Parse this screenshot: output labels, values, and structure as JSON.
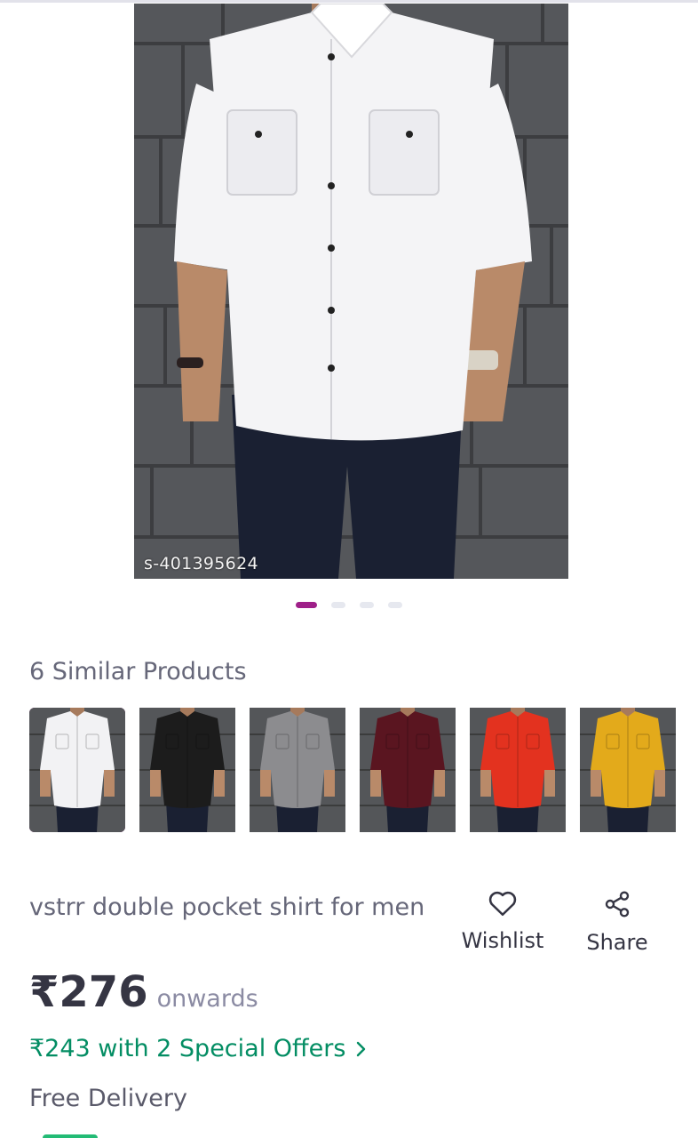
{
  "hero": {
    "watermark": "s-401395624",
    "shirt_color": "#f4f4f6"
  },
  "carousel": {
    "total": 4,
    "active": 1
  },
  "similar": {
    "title": "6 Similar Products",
    "items": [
      {
        "color": "#f2f2f4",
        "selected": true
      },
      {
        "color": "#1c1c1c",
        "selected": false
      },
      {
        "color": "#8c8c8f",
        "selected": false
      },
      {
        "color": "#5a1520",
        "selected": false
      },
      {
        "color": "#e3321f",
        "selected": false
      },
      {
        "color": "#e3aa1b",
        "selected": false
      }
    ]
  },
  "product": {
    "title": "vstrr double pocket shirt for men",
    "wishlist_label": "Wishlist",
    "share_label": "Share",
    "price": "₹276",
    "price_suffix": "onwards",
    "offer_text": "₹243 with 2 Special Offers",
    "delivery": "Free Delivery"
  },
  "colors": {
    "brand": "#9f2089",
    "offer": "#038d63"
  }
}
